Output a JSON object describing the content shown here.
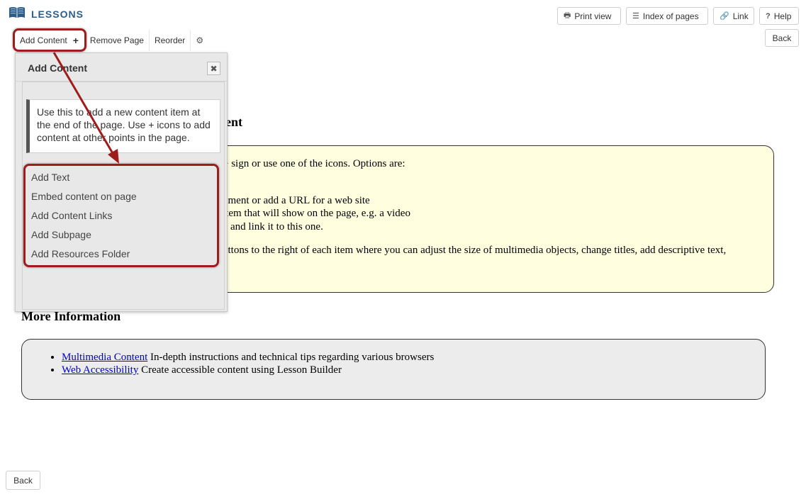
{
  "header": {
    "tool_title": "LESSONS",
    "tool_icon": "book-icon"
  },
  "top_buttons": {
    "print_view": "Print view",
    "index_of_pages": "Index of pages",
    "link": "Link",
    "help": "Help",
    "back": "Back"
  },
  "toolbar": {
    "add_content": "Add Content",
    "remove_page": "Remove Page",
    "reorder": "Reorder"
  },
  "page": {
    "heading_tail": "ent",
    "yellow_lines": [
      "+ sign or use one of the icons. Options are:",
      "-",
      "ument or add a URL for a web site",
      "item that will show on the page, e.g. a video",
      "and link it to this one.",
      "uttons to the right of each item where you can adjust the size of multimedia objects, change titles, add descriptive text,"
    ],
    "more_info_heading": "More Information",
    "links": [
      {
        "link": "Multimedia Content",
        "text": " In-depth instructions and technical tips regarding various browsers"
      },
      {
        "link": "Web Accessibility",
        "text": " Create accessible content using Lesson Builder"
      }
    ]
  },
  "popup": {
    "title": "Add Content",
    "info": "Use this to add a new content item at the end of the page. Use + icons to add content at other points in the page.",
    "menu": [
      "Add Text",
      "Embed content on page",
      "Add Content Links",
      "Add Subpage",
      "Add Resources Folder"
    ]
  },
  "footer": {
    "back": "Back"
  },
  "colors": {
    "annotation_red": "#9e1c1c",
    "title_blue": "#2c5d8a",
    "link_blue": "#0000cc"
  }
}
